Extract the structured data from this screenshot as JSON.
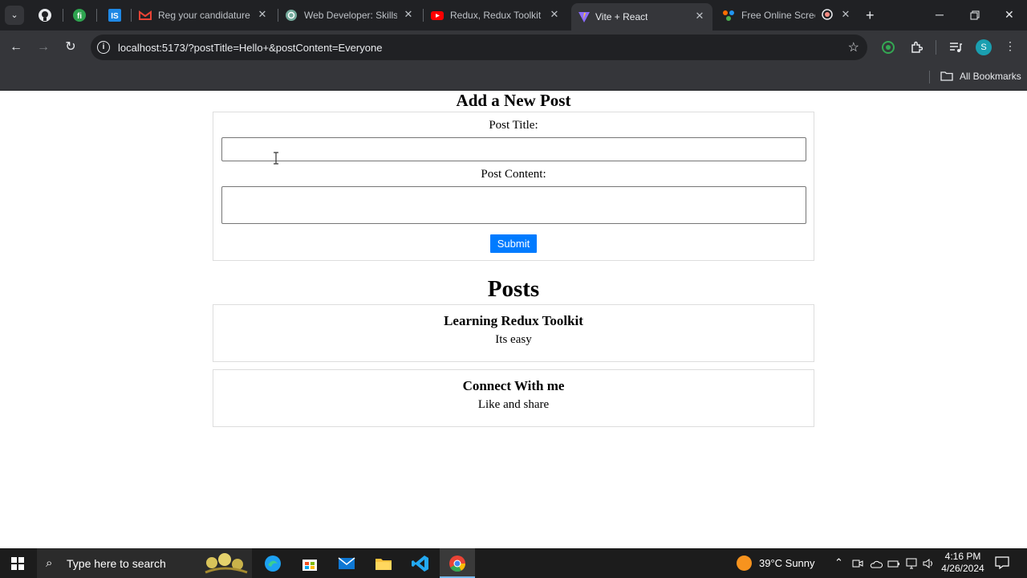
{
  "browser": {
    "tabs": [
      {
        "title": "Reg your candidature",
        "icon": "gmail-icon"
      },
      {
        "title": "Web Developer: Skills a",
        "icon": "chatgpt-icon"
      },
      {
        "title": "Redux, Redux Toolkit Tu",
        "icon": "youtube-icon"
      },
      {
        "title": "Vite + React",
        "icon": "vite-icon",
        "active": true
      },
      {
        "title": "Free Online Screen",
        "icon": "screen-recorder-icon"
      }
    ],
    "pinned_tabs": [
      "github-icon",
      "fi-icon",
      "is-icon"
    ],
    "url": "localhost:5173/?postTitle=Hello+&postContent=Everyone",
    "profile_initial": "S",
    "bookmarks_label": "All Bookmarks"
  },
  "form": {
    "heading": "Add a New Post",
    "title_label": "Post Title:",
    "title_value": "",
    "content_label": "Post Content:",
    "content_value": "",
    "submit_label": "Submit"
  },
  "posts": {
    "heading": "Posts",
    "items": [
      {
        "title": "Learning Redux Toolkit",
        "content": "Its easy"
      },
      {
        "title": "Connect With me",
        "content": "Like and share"
      }
    ]
  },
  "taskbar": {
    "search_placeholder": "Type here to search",
    "weather": "39°C  Sunny",
    "time": "4:16 PM",
    "date": "4/26/2024"
  },
  "colors": {
    "submit_bg": "#007bff",
    "browser_dark": "#202124",
    "browser_toolbar": "#35363a"
  }
}
